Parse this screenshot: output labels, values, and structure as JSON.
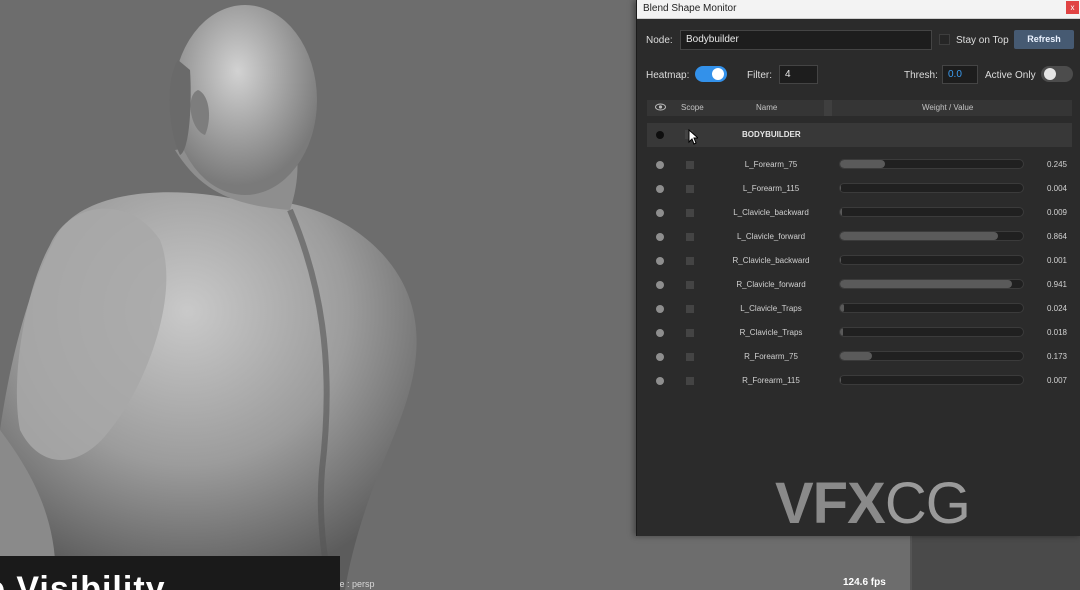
{
  "viewport": {
    "isolate_label": "Isolate : persp",
    "fps": "124.6 fps",
    "caption": "e Visibility"
  },
  "panel": {
    "title": "Blend Shape Monitor",
    "close_label": "x",
    "node_label": "Node:",
    "node_value": "Bodybuilder",
    "stay_on_top_label": "Stay on Top",
    "refresh_label": "Refresh",
    "heatmap_label": "Heatmap:",
    "heatmap_on": true,
    "filter_label": "Filter:",
    "filter_value": "4",
    "thresh_label": "Thresh:",
    "thresh_value": "0.0",
    "active_only_label": "Active Only",
    "active_only_on": false,
    "columns": {
      "vis": "eye-icon",
      "scope": "Scope",
      "name": "Name",
      "weight": "Weight / Value"
    },
    "group_name": "BODYBUILDER",
    "rows": [
      {
        "name": "L_Forearm_75",
        "value": "0.245",
        "weight": 0.245
      },
      {
        "name": "L_Forearm_115",
        "value": "0.004",
        "weight": 0.004
      },
      {
        "name": "L_Clavicle_backward",
        "value": "0.009",
        "weight": 0.009
      },
      {
        "name": "L_Clavicle_forward",
        "value": "0.864",
        "weight": 0.864
      },
      {
        "name": "R_Clavicle_backward",
        "value": "0.001",
        "weight": 0.001
      },
      {
        "name": "R_Clavicle_forward",
        "value": "0.941",
        "weight": 0.941
      },
      {
        "name": "L_Clavicle_Traps",
        "value": "0.024",
        "weight": 0.024
      },
      {
        "name": "R_Clavicle_Traps",
        "value": "0.018",
        "weight": 0.018
      },
      {
        "name": "R_Forearm_75",
        "value": "0.173",
        "weight": 0.173
      },
      {
        "name": "R_Forearm_115",
        "value": "0.007",
        "weight": 0.007
      }
    ],
    "watermark_bold": "VFX",
    "watermark_light": "CG",
    "colors": {
      "accent": "#3391ea",
      "panel_bg": "#2b2b2b",
      "bar_fill": "#5a5a5a"
    }
  }
}
